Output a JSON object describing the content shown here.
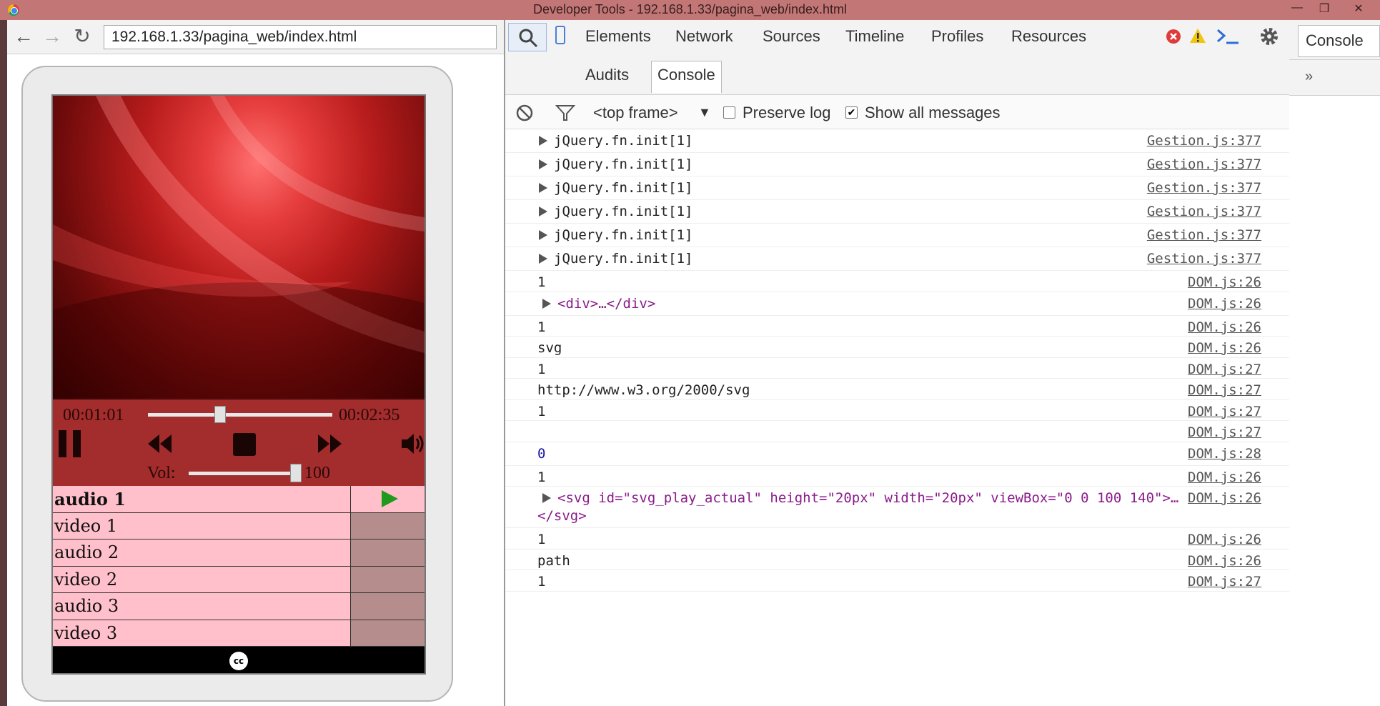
{
  "window": {
    "title": "Developer Tools - 192.168.1.33/pagina_web/index.html"
  },
  "browser": {
    "url": "192.168.1.33/pagina_web/index.html"
  },
  "player": {
    "current_time": "00:01:01",
    "total_time": "00:02:35",
    "seek_position": 0.39,
    "volume_label": "Vol:",
    "volume_value": "100",
    "volume_level": 1.0,
    "accent_color": "#a32c2c",
    "playlist": [
      {
        "name": "audio 1",
        "active": true
      },
      {
        "name": "video 1",
        "active": false
      },
      {
        "name": "audio 2",
        "active": false
      },
      {
        "name": "video 2",
        "active": false
      },
      {
        "name": "audio 3",
        "active": false
      },
      {
        "name": "video 3",
        "active": false
      }
    ],
    "footer_icon": "cc-icon",
    "footer_icon_text": "cc"
  },
  "devtools": {
    "tabs": [
      "Elements",
      "Network",
      "Sources",
      "Timeline",
      "Profiles",
      "Resources"
    ],
    "tabs_row2": [
      "Audits",
      "Console"
    ],
    "active_tab": "Console",
    "frame_selector": "<top frame>",
    "preserve_log_label": "Preserve log",
    "preserve_log_checked": false,
    "show_all_label": "Show all messages",
    "show_all_checked": true,
    "right_tab": "Console",
    "right_more": "»"
  },
  "console_logs": [
    {
      "msg": "jQuery.fn.init[1]",
      "src": "Gestion.js:377",
      "expand": true,
      "style": "normal"
    },
    {
      "msg": "jQuery.fn.init[1]",
      "src": "Gestion.js:377",
      "expand": true,
      "style": "normal"
    },
    {
      "msg": "jQuery.fn.init[1]",
      "src": "Gestion.js:377",
      "expand": true,
      "style": "normal"
    },
    {
      "msg": "jQuery.fn.init[1]",
      "src": "Gestion.js:377",
      "expand": true,
      "style": "normal"
    },
    {
      "msg": "jQuery.fn.init[1]",
      "src": "Gestion.js:377",
      "expand": true,
      "style": "normal"
    },
    {
      "msg": "jQuery.fn.init[1]",
      "src": "Gestion.js:377",
      "expand": true,
      "style": "normal"
    },
    {
      "msg": "1",
      "src": "DOM.js:26",
      "expand": false,
      "style": "normal"
    },
    {
      "msg": "<div>…</div>",
      "src": "DOM.js:26",
      "expand": true,
      "style": "purple"
    },
    {
      "msg": "1",
      "src": "DOM.js:26",
      "expand": false,
      "style": "normal"
    },
    {
      "msg": "svg",
      "src": "DOM.js:26",
      "expand": false,
      "style": "normal"
    },
    {
      "msg": "1",
      "src": "DOM.js:27",
      "expand": false,
      "style": "normal"
    },
    {
      "msg": "http://www.w3.org/2000/svg",
      "src": "DOM.js:27",
      "expand": false,
      "style": "normal"
    },
    {
      "msg": "1",
      "src": "DOM.js:27",
      "expand": false,
      "style": "normal"
    },
    {
      "msg": "",
      "src": "DOM.js:27",
      "expand": false,
      "style": "normal"
    },
    {
      "msg": "0",
      "src": "DOM.js:28",
      "expand": false,
      "style": "blue"
    },
    {
      "msg": "1",
      "src": "DOM.js:26",
      "expand": false,
      "style": "normal"
    },
    {
      "msg": "<svg id=\"svg_play_actual\" height=\"20px\" width=\"20px\" viewBox=\"0 0 100 140\">…",
      "msg2": "</svg>",
      "src": "DOM.js:26",
      "expand": true,
      "style": "purple"
    },
    {
      "msg": "1",
      "src": "DOM.js:26",
      "expand": false,
      "style": "normal"
    },
    {
      "msg": "path",
      "src": "DOM.js:26",
      "expand": false,
      "style": "normal"
    },
    {
      "msg": "1",
      "src": "DOM.js:27",
      "expand": false,
      "style": "normal"
    }
  ]
}
